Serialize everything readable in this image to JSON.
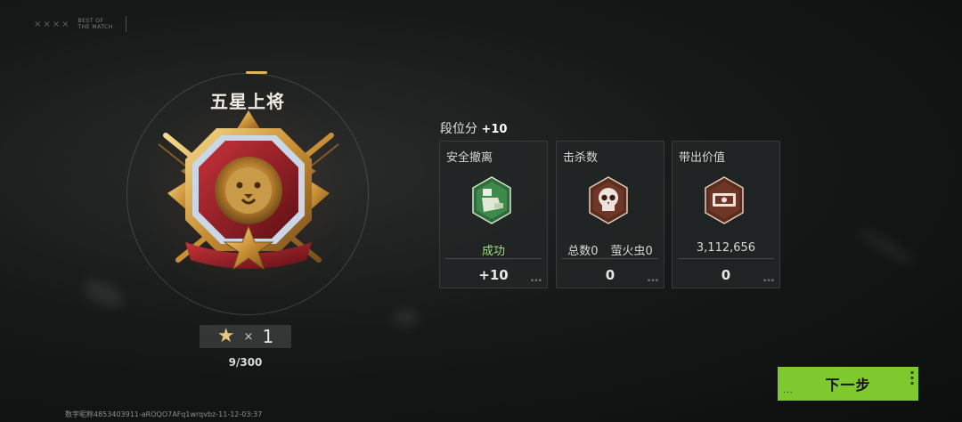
{
  "logo": {
    "marks": "××××",
    "line1": "BEST OF",
    "line2": "THE MATCH"
  },
  "rank": {
    "title": "五星上将",
    "stars": "★",
    "multiplier": "×",
    "star_count": "1",
    "progress": "9/300"
  },
  "score": {
    "label": "段位分",
    "value": "+10"
  },
  "cards": [
    {
      "title": "安全撤离",
      "icon": "soldier-icon",
      "sub": "成功",
      "value": "+10",
      "sub_color": "#9fe07a"
    },
    {
      "title": "击杀数",
      "icon": "skull-icon",
      "sub_total": "总数0",
      "sub_firefly": "萤火虫0",
      "value": "0"
    },
    {
      "title": "带出价值",
      "icon": "cash-icon",
      "sub": "3,112,656",
      "value": "0"
    }
  ],
  "next_button": {
    "label": "下一步",
    "dots": "..."
  },
  "footer": {
    "text": "数字昵称4853403911-aROQO7AFq1wrqvbz-11-12-03:37"
  },
  "colors": {
    "accent": "#7fc82e",
    "gold": "#e6c77d",
    "ring_tick": "#e2b35a"
  }
}
